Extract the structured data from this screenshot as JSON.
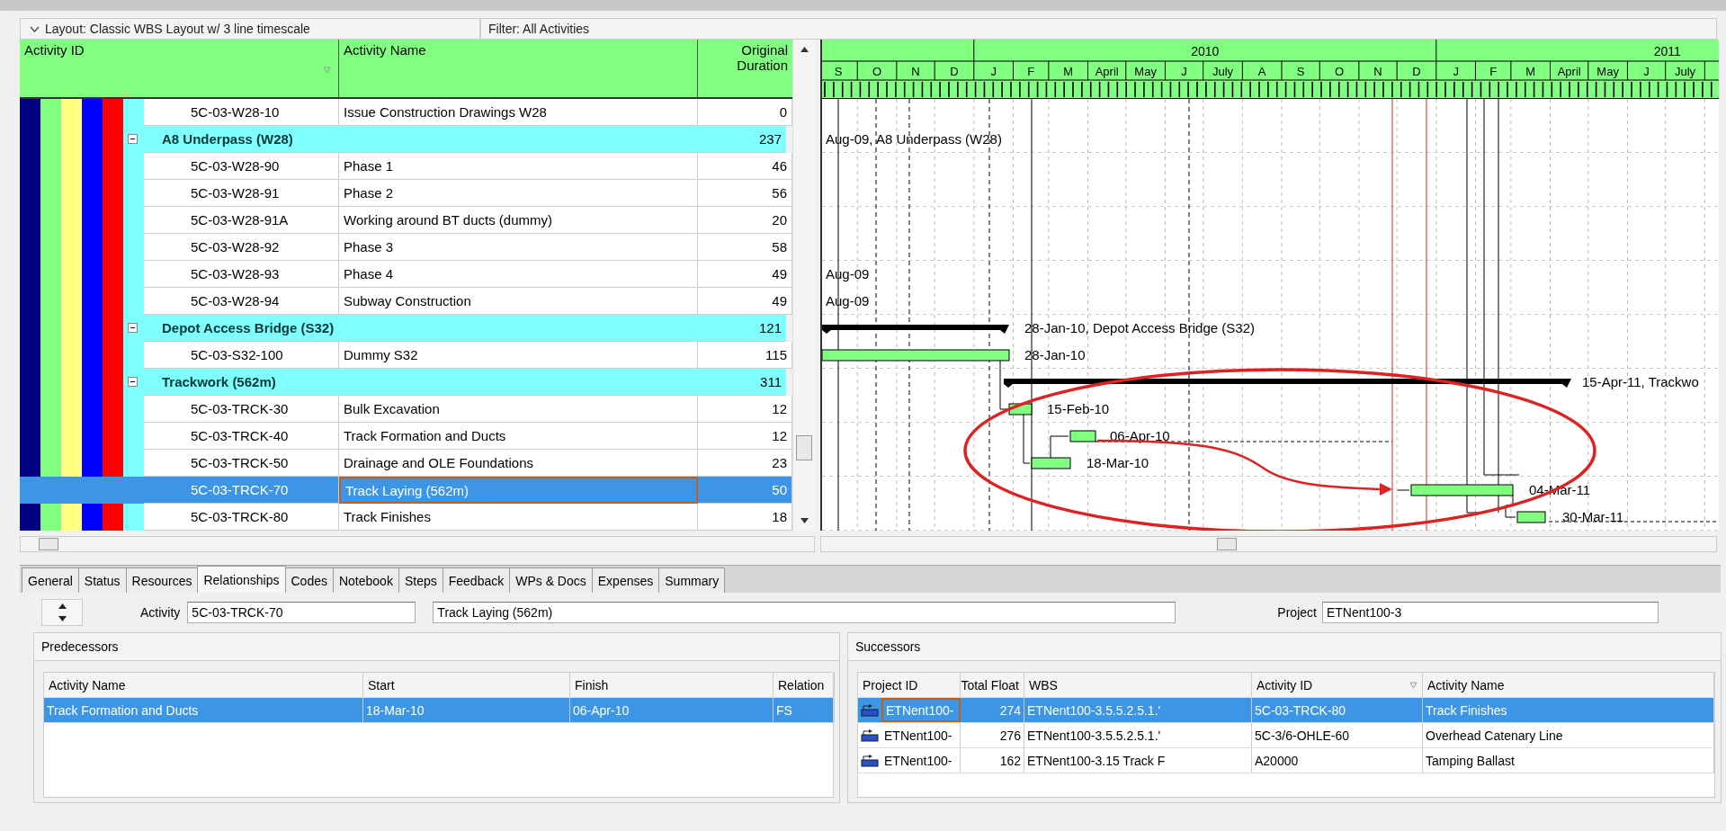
{
  "layout_bar": {
    "layout": "Layout: Classic WBS Layout w/ 3 line timescale",
    "filter": "Filter: All Activities"
  },
  "wbs_bands": [
    {
      "color": "#000080"
    },
    {
      "color": "#80ff80"
    },
    {
      "color": "#ffff80"
    },
    {
      "color": "#0000ff"
    },
    {
      "color": "#ff0000"
    },
    {
      "color": "#80ffff"
    }
  ],
  "activity_table": {
    "columns": [
      "Activity ID",
      "Activity Name",
      "Original Duration"
    ],
    "rows": [
      {
        "kind": "activity",
        "id": "5C-03-W28-10",
        "name": "Issue Construction Drawings W28",
        "duration": "0",
        "selected": false
      },
      {
        "kind": "wbs",
        "name": "A8 Underpass (W28)",
        "duration": "237",
        "selected": false,
        "bar": {
          "kind": "label",
          "label": "Aug-09, A8 Underpass (W28)"
        }
      },
      {
        "kind": "activity",
        "id": "5C-03-W28-90",
        "name": "Phase 1",
        "duration": "46",
        "selected": false
      },
      {
        "kind": "activity",
        "id": "5C-03-W28-91",
        "name": "Phase 2",
        "duration": "56",
        "selected": false
      },
      {
        "kind": "activity",
        "id": "5C-03-W28-91A",
        "name": "Working around BT ducts (dummy)",
        "duration": "20",
        "selected": false
      },
      {
        "kind": "activity",
        "id": "5C-03-W28-92",
        "name": "Phase 3",
        "duration": "58",
        "selected": false
      },
      {
        "kind": "activity",
        "id": "5C-03-W28-93",
        "name": "Phase 4",
        "duration": "49",
        "selected": false,
        "bar": {
          "kind": "label",
          "label": "Aug-09"
        }
      },
      {
        "kind": "activity",
        "id": "5C-03-W28-94",
        "name": "Subway Construction",
        "duration": "49",
        "selected": false,
        "bar": {
          "kind": "label",
          "label": "Aug-09"
        }
      },
      {
        "kind": "wbs",
        "name": "Depot Access Bridge (S32)",
        "duration": "121",
        "selected": false,
        "bar": {
          "kind": "summary",
          "label": "28-Jan-10, Depot Access Bridge (S32)"
        }
      },
      {
        "kind": "activity",
        "id": "5C-03-S32-100",
        "name": "Dummy S32",
        "duration": "115",
        "selected": false,
        "bar": {
          "kind": "task",
          "label": "28-Jan-10"
        }
      },
      {
        "kind": "wbs",
        "name": "Trackwork (562m)",
        "duration": "311",
        "selected": false,
        "bar": {
          "kind": "summary",
          "label": "15-Apr-11, Trackwo"
        }
      },
      {
        "kind": "activity",
        "id": "5C-03-TRCK-30",
        "name": "Bulk Excavation",
        "duration": "12",
        "selected": false,
        "bar": {
          "kind": "task",
          "label": "15-Feb-10"
        }
      },
      {
        "kind": "activity",
        "id": "5C-03-TRCK-40",
        "name": "Track Formation and Ducts",
        "duration": "12",
        "selected": false,
        "bar": {
          "kind": "task",
          "label": "06-Apr-10"
        }
      },
      {
        "kind": "activity",
        "id": "5C-03-TRCK-50",
        "name": "Drainage and OLE Foundations",
        "duration": "23",
        "selected": false,
        "bar": {
          "kind": "task",
          "label": "18-Mar-10"
        }
      },
      {
        "kind": "activity",
        "id": "5C-03-TRCK-70",
        "name": "Track Laying (562m)",
        "duration": "50",
        "selected": true,
        "bar": {
          "kind": "task",
          "label": "04-Mar-11"
        }
      },
      {
        "kind": "activity",
        "id": "5C-03-TRCK-80",
        "name": "Track Finishes",
        "duration": "18",
        "selected": false,
        "bar": {
          "kind": "task",
          "label": "30-Mar-11"
        }
      }
    ]
  },
  "timescale": {
    "years": [
      {
        "months": [
          "S",
          "O",
          "N",
          "D"
        ]
      },
      {
        "label": "2010",
        "months": [
          "J",
          "F",
          "M",
          "April",
          "May",
          "J",
          "July",
          "A",
          "S",
          "O",
          "N",
          "D"
        ]
      },
      {
        "label": "2011",
        "months": [
          "J",
          "F",
          "M",
          "April",
          "May",
          "J",
          "July"
        ]
      }
    ]
  },
  "tabs": [
    {
      "label": "General",
      "selected": false
    },
    {
      "label": "Status",
      "selected": false
    },
    {
      "label": "Resources",
      "selected": false
    },
    {
      "label": "Relationships",
      "selected": true
    },
    {
      "label": "Codes",
      "selected": false
    },
    {
      "label": "Notebook",
      "selected": false
    },
    {
      "label": "Steps",
      "selected": false
    },
    {
      "label": "Feedback",
      "selected": false
    },
    {
      "label": "WPs & Docs",
      "selected": false
    },
    {
      "label": "Expenses",
      "selected": false
    },
    {
      "label": "Summary",
      "selected": false
    }
  ],
  "activity_bar": {
    "label": "Activity",
    "id": "5C-03-TRCK-70",
    "name": "Track Laying (562m)",
    "project_label": "Project",
    "project": "ETNent100-3"
  },
  "predecessors": {
    "title": "Predecessors",
    "columns": [
      "Activity Name",
      "Start",
      "Finish",
      "Relation"
    ],
    "rows": [
      {
        "cells": [
          "Track Formation and Ducts",
          "18-Mar-10",
          "06-Apr-10",
          "FS"
        ],
        "selected": true
      }
    ]
  },
  "successors": {
    "title": "Successors",
    "columns": [
      "Project ID",
      "Total Float",
      "WBS",
      "Activity ID",
      "Activity Name"
    ],
    "rows": [
      {
        "cells": [
          "ETNent100-",
          "274",
          "ETNent100-3.5.5.2.5.1.'",
          "5C-03-TRCK-80",
          "Track Finishes"
        ],
        "selected": true
      },
      {
        "cells": [
          "ETNent100-",
          "276",
          "ETNent100-3.5.5.2.5.1.'",
          "5C-3/6-OHLE-60",
          "Overhead Catenary Line"
        ],
        "selected": false
      },
      {
        "cells": [
          "ETNent100-",
          "162",
          "ETNent100-3.15 Track F",
          "A20000",
          "Tamping Ballast"
        ],
        "selected": false
      }
    ]
  }
}
